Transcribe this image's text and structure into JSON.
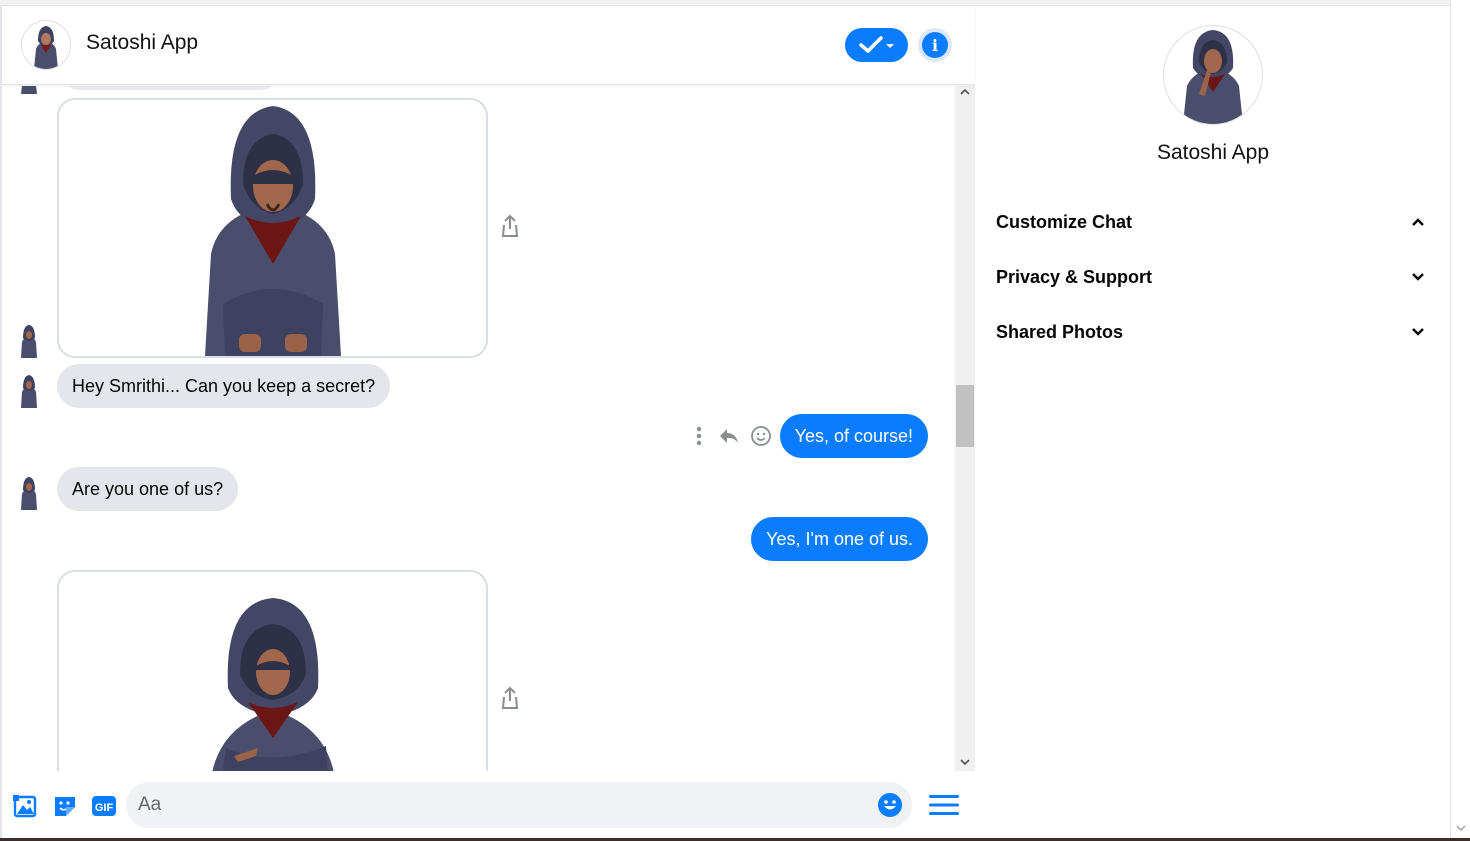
{
  "header": {
    "title": "Satoshi App"
  },
  "messages": [
    {
      "type": "image",
      "from": "them"
    },
    {
      "type": "text",
      "from": "them",
      "text": "Hey Smrithi... Can you keep a secret?"
    },
    {
      "type": "text",
      "from": "me",
      "text": "Yes, of course!"
    },
    {
      "type": "text",
      "from": "them",
      "text": "Are you one of us?"
    },
    {
      "type": "text",
      "from": "me",
      "text": "Yes, I'm one of us."
    },
    {
      "type": "image",
      "from": "them"
    }
  ],
  "composer": {
    "placeholder": "Aa",
    "gif_label": "GIF"
  },
  "info_panel": {
    "name": "Satoshi App",
    "sections": [
      {
        "label": "Customize Chat",
        "expanded": true
      },
      {
        "label": "Privacy & Support",
        "expanded": false
      },
      {
        "label": "Shared Photos",
        "expanded": false
      }
    ]
  },
  "colors": {
    "accent": "#0a7cff",
    "incoming_bubble": "#e4e6eb",
    "hoodie": "#4a4d6b",
    "scarf": "#7a1a1a"
  },
  "icons": [
    "check-icon",
    "info-icon",
    "share-icon",
    "more-icon",
    "reply-icon",
    "react-icon",
    "photo-icon",
    "sticker-icon",
    "gif-icon",
    "emoji-icon",
    "menu-icon",
    "chevron-up-icon",
    "chevron-down-icon"
  ]
}
